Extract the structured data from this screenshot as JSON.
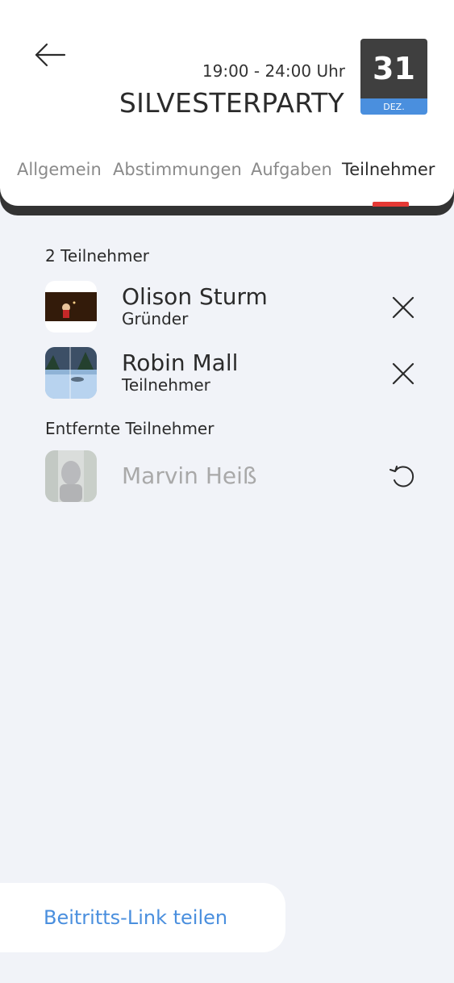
{
  "event": {
    "time": "19:00 - 24:00 Uhr",
    "title": "SILVESTERPARTY",
    "date_day": "31",
    "date_month": "DEZ."
  },
  "tabs": [
    {
      "label": "Allgemein",
      "active": false
    },
    {
      "label": "Abstimmungen",
      "active": false
    },
    {
      "label": "Aufgaben",
      "active": false
    },
    {
      "label": "Teilnehmer",
      "active": true
    }
  ],
  "participants": {
    "heading": "2 Teilnehmer",
    "items": [
      {
        "name": "Olison Sturm",
        "role": "Gründer",
        "action_icon": "close-icon"
      },
      {
        "name": "Robin Mall",
        "role": "Teilnehmer",
        "action_icon": "close-icon"
      }
    ]
  },
  "removed": {
    "heading": "Entfernte Teilnehmer",
    "items": [
      {
        "name": "Marvin Heiß",
        "action_icon": "restore-icon"
      }
    ]
  },
  "share_button": {
    "label": "Beitritts-Link teilen"
  },
  "colors": {
    "accent": "#4a8fde",
    "tab_indicator": "#e53935",
    "badge_dark": "#3f3f3f",
    "background": "#f1f3f8"
  }
}
